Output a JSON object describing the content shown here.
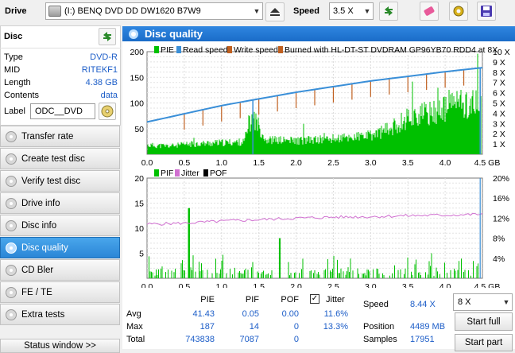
{
  "toolbar": {
    "drive_label": "Drive",
    "drive_value": "(I:)   BENQ DVD DD DW1620 B7W9",
    "speed_label": "Speed",
    "speed_value": "3.5 X"
  },
  "disc": {
    "title": "Disc",
    "fields": [
      {
        "key": "Type",
        "value": "DVD-R"
      },
      {
        "key": "MID",
        "value": "RITEKF1"
      },
      {
        "key": "Length",
        "value": "4.38 GB"
      },
      {
        "key": "Contents",
        "value": "data"
      }
    ],
    "label_key": "Label",
    "label_value": "ODC__DVD"
  },
  "nav": [
    {
      "label": "Transfer rate",
      "active": false
    },
    {
      "label": "Create test disc",
      "active": false
    },
    {
      "label": "Verify test disc",
      "active": false
    },
    {
      "label": "Drive info",
      "active": false
    },
    {
      "label": "Disc info",
      "active": false
    },
    {
      "label": "Disc quality",
      "active": true
    },
    {
      "label": "CD Bler",
      "active": false
    },
    {
      "label": "FE / TE",
      "active": false
    },
    {
      "label": "Extra tests",
      "active": false
    }
  ],
  "status_window": "Status window >>",
  "panel_title": "Disc quality",
  "colors": {
    "pie": "#00c000",
    "pif": "#00c000",
    "jitter": "#d070d0",
    "read": "#3a8fd8",
    "write": "#c06020",
    "header": "#1c6fd0"
  },
  "chart_data": [
    {
      "type": "area",
      "legend": [
        "PIE",
        "Read speed",
        "Write speed",
        "Burned with HL-DT-ST DVDRAM GP96YB70 RDD4 at 8X"
      ],
      "xlim": [
        0,
        4.5
      ],
      "ylim": [
        0,
        200
      ],
      "x_ticks": [
        "0.0",
        "0.5",
        "1.0",
        "1.5",
        "2.0",
        "2.5",
        "3.0",
        "3.5",
        "4.0",
        "4.5 GB"
      ],
      "y_ticks": [
        "200",
        "150",
        "100",
        "50"
      ],
      "y2_ticks": [
        "10 X",
        "9 X",
        "8 X",
        "7 X",
        "6 X",
        "5 X",
        "4 X",
        "3 X",
        "2 X",
        "1 X"
      ],
      "pie_envelope": {
        "x": [
          0,
          0.3,
          0.6,
          1.0,
          1.3,
          1.42,
          1.6,
          2.0,
          2.4,
          2.8,
          3.0,
          3.3,
          3.5,
          3.8,
          4.0,
          4.1,
          4.3,
          4.5
        ],
        "y": [
          22,
          20,
          25,
          28,
          30,
          95,
          35,
          33,
          36,
          42,
          45,
          65,
          90,
          100,
          110,
          130,
          120,
          125
        ]
      },
      "read_speed_x": {
        "x": [
          0,
          1,
          2,
          3,
          4,
          4.5
        ],
        "y": [
          3.3,
          4.9,
          6.2,
          7.3,
          8.2,
          8.6
        ]
      }
    },
    {
      "type": "area",
      "legend": [
        "PIF",
        "Jitter",
        "POF"
      ],
      "xlim": [
        0,
        4.5
      ],
      "ylim": [
        0,
        20
      ],
      "x_ticks": [
        "0.0",
        "0.5",
        "1.0",
        "1.5",
        "2.0",
        "2.5",
        "3.0",
        "3.5",
        "4.0",
        "4.5 GB"
      ],
      "y_ticks": [
        "20",
        "15",
        "10",
        "5"
      ],
      "y2_ticks": [
        "20%",
        "16%",
        "12%",
        "8%",
        "4%"
      ],
      "jitter_percent": {
        "x": [
          0,
          0.5,
          1.0,
          1.5,
          2.0,
          2.5,
          3.0,
          3.5,
          4.0,
          4.5
        ],
        "y": [
          10.8,
          11.0,
          11.4,
          11.7,
          12.0,
          12.2,
          12.3,
          12.5,
          12.6,
          12.8
        ]
      }
    }
  ],
  "stats": {
    "headers": [
      "PIE",
      "PIF",
      "POF",
      "Jitter"
    ],
    "rows": [
      {
        "label": "Avg",
        "pie": "41.43",
        "pif": "0.05",
        "pof": "0.00",
        "jitter": "11.6%"
      },
      {
        "label": "Max",
        "pie": "187",
        "pif": "14",
        "pof": "0",
        "jitter": "13.3%"
      },
      {
        "label": "Total",
        "pie": "743838",
        "pif": "7087",
        "pof": "0",
        "jitter": ""
      }
    ],
    "speed_label": "Speed",
    "speed_value": "8.44 X",
    "position_label": "Position",
    "position_value": "4489 MB",
    "samples_label": "Samples",
    "samples_value": "17951",
    "speed_select": "8 X",
    "start_full": "Start full",
    "start_part": "Start part"
  }
}
